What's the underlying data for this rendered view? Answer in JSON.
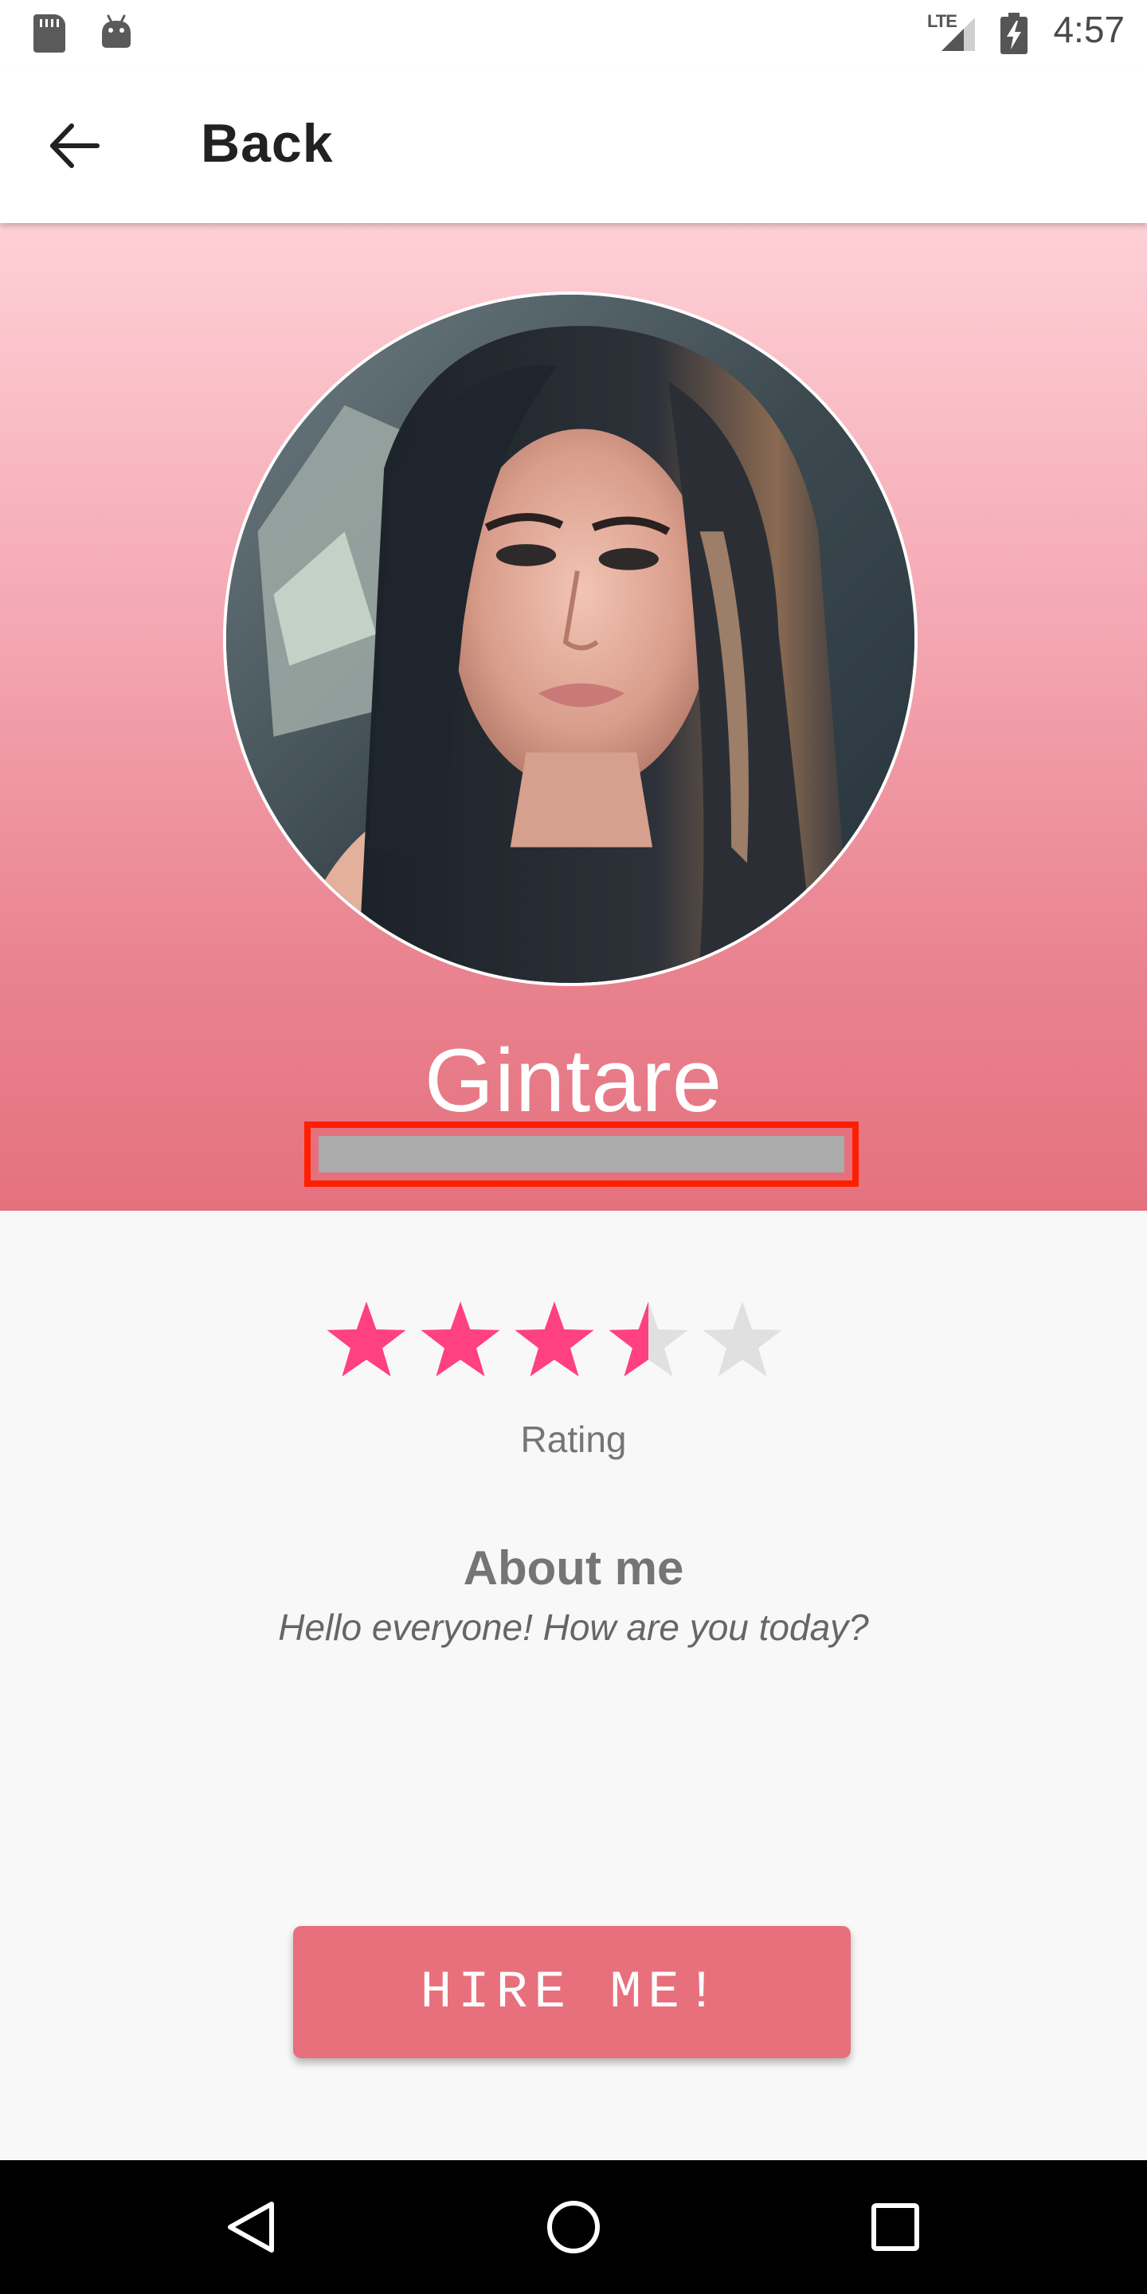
{
  "status_bar": {
    "time": "4:57",
    "network": "LTE",
    "icons": [
      "sd-card-icon",
      "android-icon",
      "lte-signal-icon",
      "battery-charging-icon"
    ]
  },
  "app_bar": {
    "back_icon": "arrow-left-icon",
    "title": "Back"
  },
  "profile": {
    "name": "Gintare",
    "avatar": "profile-photo",
    "subtitle_redacted": true
  },
  "rating": {
    "value": 3.5,
    "max": 5,
    "label": "Rating",
    "star_color": "#ff4081",
    "empty_star_color": "#e0e0e0"
  },
  "about": {
    "title": "About me",
    "text": "Hello everyone! How are you today?"
  },
  "action": {
    "hire_label": "HIRE ME!",
    "color": "#e8707d"
  },
  "nav_bar": {
    "buttons": [
      "back-triangle-icon",
      "home-circle-icon",
      "recents-square-icon"
    ]
  },
  "colors": {
    "header_top": "#fed0d6",
    "header_bottom": "#e5717e",
    "redaction_border": "#ff1e00",
    "redaction_fill": "#ababab"
  }
}
